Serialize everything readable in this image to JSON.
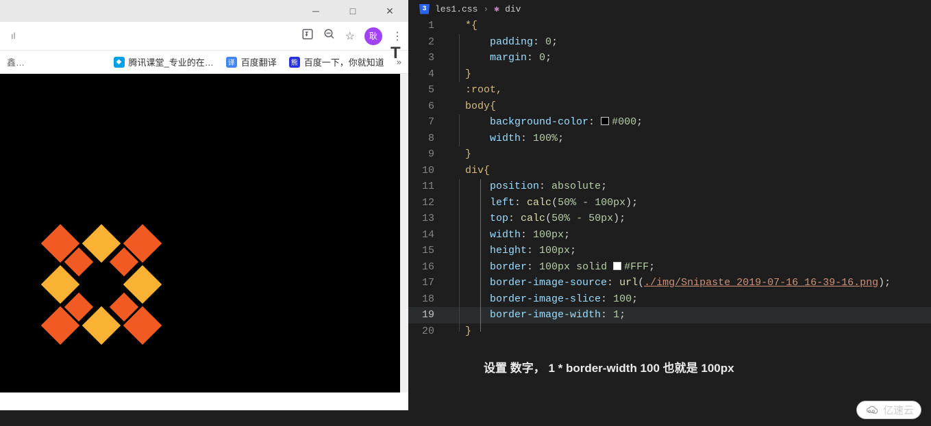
{
  "browser": {
    "window_controls": {
      "min": "─",
      "max": "□",
      "close": "✕"
    },
    "url_stub": "ıl",
    "avatar_text": "耿",
    "toolbar_icons": {
      "translate": "⎋",
      "zoom": "⊖",
      "star": "☆",
      "menu": "⋮"
    },
    "bookmarks": {
      "left_trunc": "鑫…",
      "items": [
        {
          "label": "腾讯课堂_专业的在…",
          "icon_color": "fi-teal"
        },
        {
          "label": "百度翻译",
          "icon_color": "fi-blue",
          "badge": "译"
        },
        {
          "label": "百度一下，你就知道",
          "icon_color": "fi-red",
          "badge": "🐾"
        }
      ],
      "overflow": "»"
    }
  },
  "editor": {
    "breadcrumbs": {
      "file": "les1.css",
      "selector": "div"
    },
    "lines": [
      {
        "n": 1,
        "type": "sel",
        "text_sel": "*",
        "text_after": "{"
      },
      {
        "n": 2,
        "type": "prop",
        "prop": "padding",
        "val_num": "0"
      },
      {
        "n": 3,
        "type": "prop",
        "prop": "margin",
        "val_num": "0"
      },
      {
        "n": 4,
        "type": "close"
      },
      {
        "n": 5,
        "type": "sel_only",
        "text": ":root,"
      },
      {
        "n": 6,
        "type": "sel",
        "text_sel": "body",
        "text_after": "{"
      },
      {
        "n": 7,
        "type": "prop_color",
        "prop": "background-color",
        "hex": "#000",
        "swatch": "sw-black"
      },
      {
        "n": 8,
        "type": "prop",
        "prop": "width",
        "val_num": "100%"
      },
      {
        "n": 9,
        "type": "close"
      },
      {
        "n": 10,
        "type": "sel",
        "text_sel": "div",
        "text_after": "{"
      },
      {
        "n": 11,
        "type": "prop_calc",
        "prop": "position",
        "val_kw": "absolute"
      },
      {
        "n": 12,
        "type": "calc",
        "prop": "left",
        "expr": "50% - 100px"
      },
      {
        "n": 13,
        "type": "calc",
        "prop": "top",
        "expr": "50% - 50px"
      },
      {
        "n": 14,
        "type": "prop",
        "prop": "width",
        "val_num": "100px"
      },
      {
        "n": 15,
        "type": "prop",
        "prop": "height",
        "val_num": "100px"
      },
      {
        "n": 16,
        "type": "border",
        "prop": "border",
        "size": "100px",
        "style": "solid",
        "hex": "#FFF",
        "swatch": "sw-white"
      },
      {
        "n": 17,
        "type": "url",
        "prop": "border-image-source",
        "url": "./img/Snipaste_2019-07-16_16-39-16.png"
      },
      {
        "n": 18,
        "type": "prop",
        "prop": "border-image-slice",
        "val_num": "100"
      },
      {
        "n": 19,
        "type": "prop",
        "prop": "border-image-width",
        "val_num": "1",
        "active": true
      },
      {
        "n": 20,
        "type": "close"
      }
    ],
    "annotation": "设置 数字，  1 * border-width 100  也就是   100px"
  },
  "watermark": "亿速云"
}
